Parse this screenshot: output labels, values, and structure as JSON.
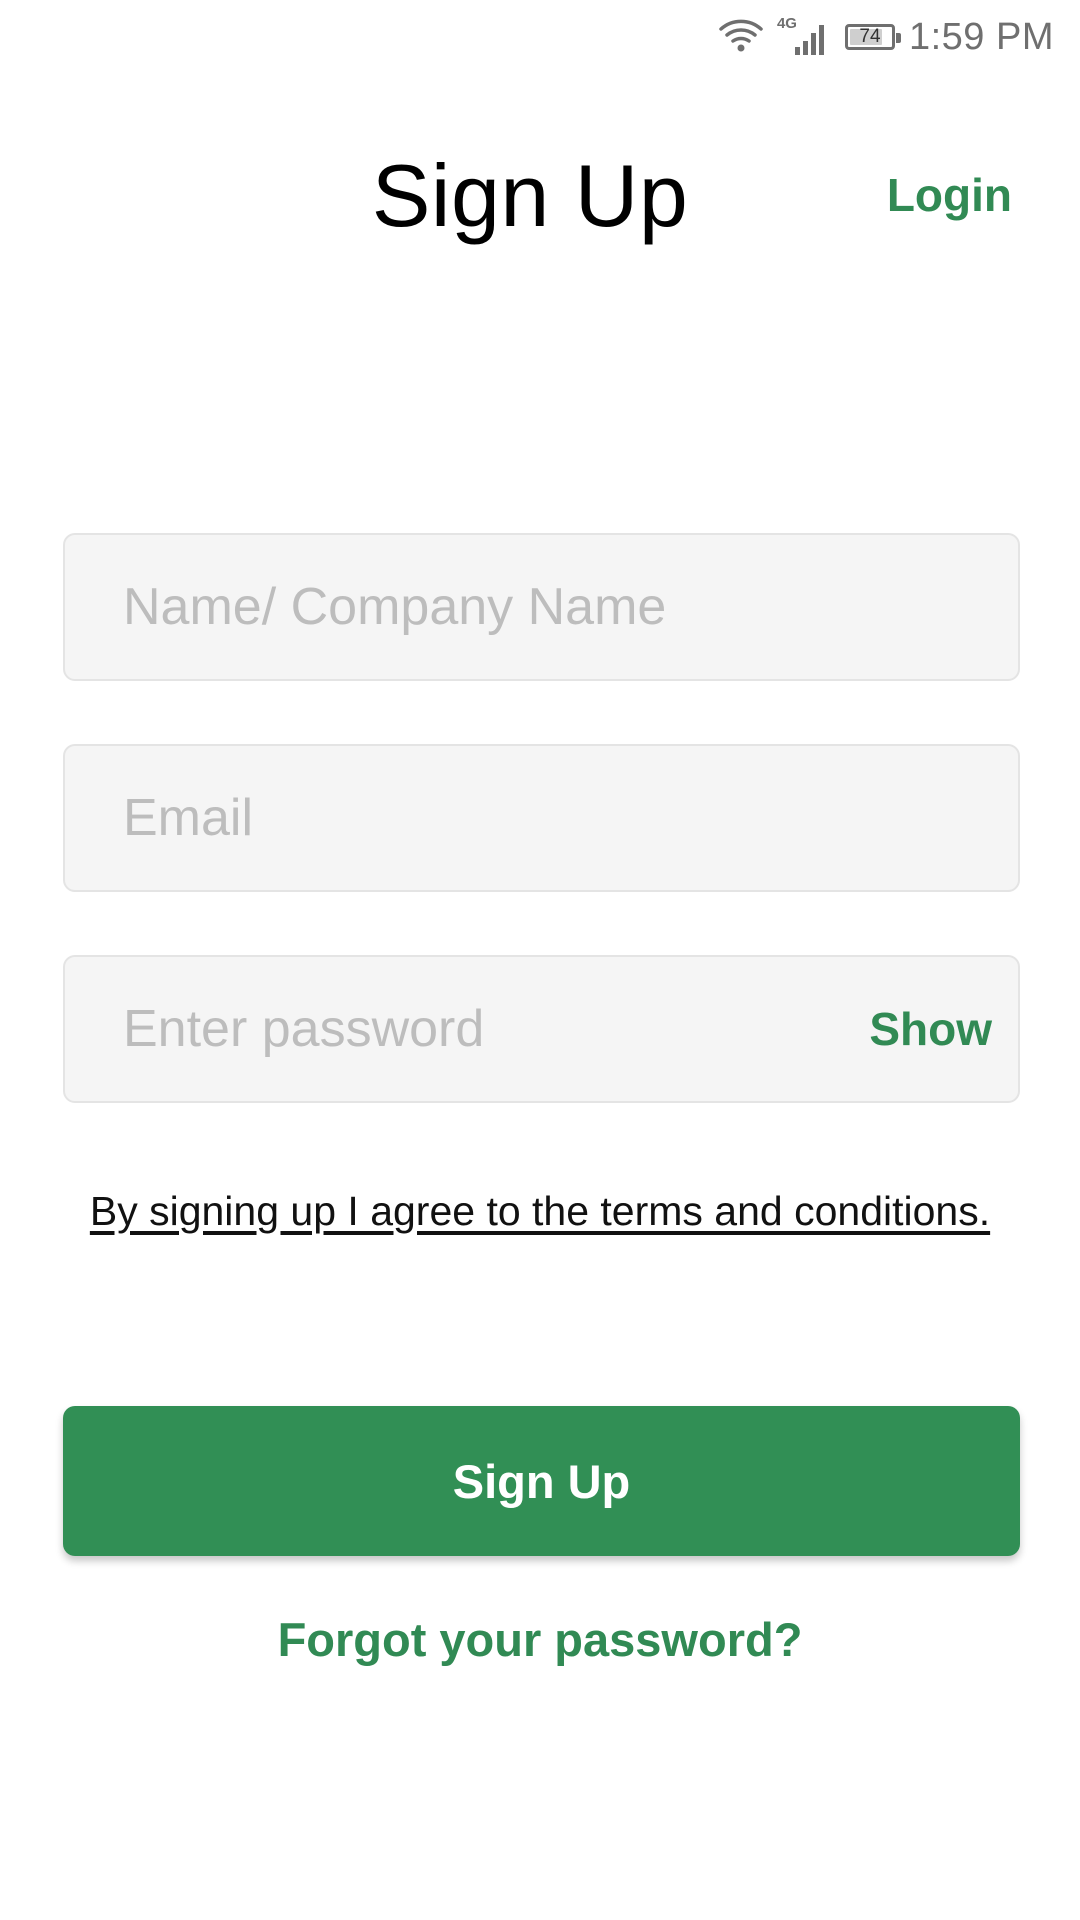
{
  "status_bar": {
    "time": "1:59 PM",
    "battery_level": "74",
    "network_label": "4G",
    "icons": [
      "wifi-icon",
      "cellular-signal-icon",
      "battery-icon"
    ]
  },
  "header": {
    "title": "Sign Up",
    "login_label": "Login"
  },
  "form": {
    "name_placeholder": "Name/ Company Name",
    "name_value": "",
    "email_placeholder": "Email",
    "email_value": "",
    "password_placeholder": "Enter password",
    "password_value": "",
    "show_label": "Show",
    "terms_text": "By signing up I agree to the terms and conditions.",
    "submit_label": "Sign Up",
    "forgot_label": "Forgot your password?"
  },
  "colors": {
    "accent": "#318a54",
    "button_bg": "#318f55",
    "field_bg": "#f5f5f5",
    "field_border": "#e4e4e4",
    "placeholder": "#bdbdbd"
  }
}
